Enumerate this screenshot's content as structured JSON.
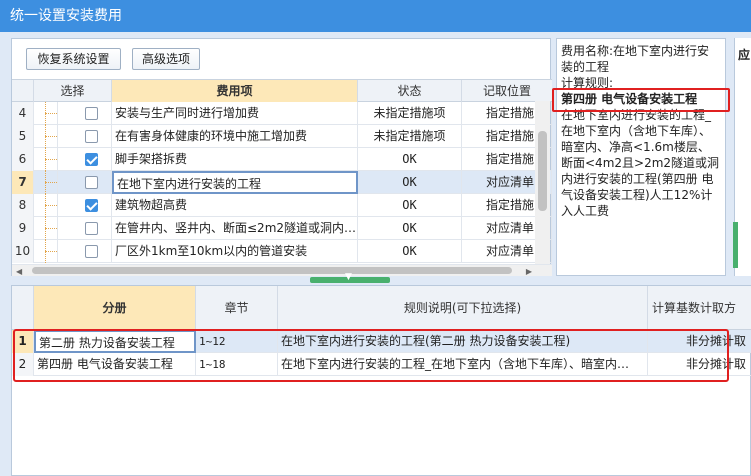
{
  "window": {
    "title": "统一设置安装费用"
  },
  "toolbar": {
    "restore_label": "恢复系统设置",
    "advanced_label": "高级选项"
  },
  "top_grid": {
    "columns": {
      "select": "选择",
      "item": "费用项",
      "status": "状态",
      "position": "记取位置"
    },
    "rows": [
      {
        "num": "4",
        "checked": false,
        "name": "安装与生产同时进行增加费",
        "status": "未指定措施项",
        "position": "指定措施"
      },
      {
        "num": "5",
        "checked": false,
        "name": "在有害身体健康的环境中施工增加费",
        "status": "未指定措施项",
        "position": "指定措施"
      },
      {
        "num": "6",
        "checked": true,
        "name": "脚手架搭拆费",
        "status": "OK",
        "position": "指定措施"
      },
      {
        "num": "7",
        "checked": false,
        "name": "在地下室内进行安装的工程",
        "status": "OK",
        "position": "对应清单"
      },
      {
        "num": "8",
        "checked": true,
        "name": "建筑物超高费",
        "status": "OK",
        "position": "指定措施"
      },
      {
        "num": "9",
        "checked": false,
        "name": "在管井内、竖井内、断面≤2m2隧道或洞内…",
        "status": "OK",
        "position": "对应清单"
      },
      {
        "num": "10",
        "checked": false,
        "name": "厂区外1km至10km以内的管道安装",
        "status": "OK",
        "position": "对应清单"
      }
    ]
  },
  "info": {
    "line1": "费用名称:在地下室内进行安装的工程",
    "line2": "计算规则:",
    "highlight": "第四册 电气设备安装工程",
    "body": "在地下室内进行安装的工程_在地下室内（含地下车库）、暗室内、净高<1.6m楼层、断面<4m2且>2m2隧道或洞内进行安装的工程(第四册 电气设备安装工程)人工12%计入人工费"
  },
  "side": {
    "label": "应"
  },
  "bottom_grid": {
    "columns": {
      "volume": "分册",
      "chapter": "章节",
      "rule": "规则说明(可下拉选择)",
      "base": "计算基数计取方"
    },
    "rows": [
      {
        "num": "1",
        "volume": "第二册 热力设备安装工程",
        "chapter": "1~12",
        "rule": "在地下室内进行安装的工程(第二册 热力设备安装工程)",
        "base": "非分摊计取"
      },
      {
        "num": "2",
        "volume": "第四册 电气设备安装工程",
        "chapter": "1~18",
        "rule": "在地下室内进行安装的工程_在地下室内（含地下车库）、暗室内…",
        "base": "非分摊计取"
      }
    ]
  },
  "colors": {
    "titlebar": "#3d8fe0",
    "highlight_header": "#fde8b8",
    "annotation_red": "#e02020",
    "splitter": "#49b06e"
  }
}
